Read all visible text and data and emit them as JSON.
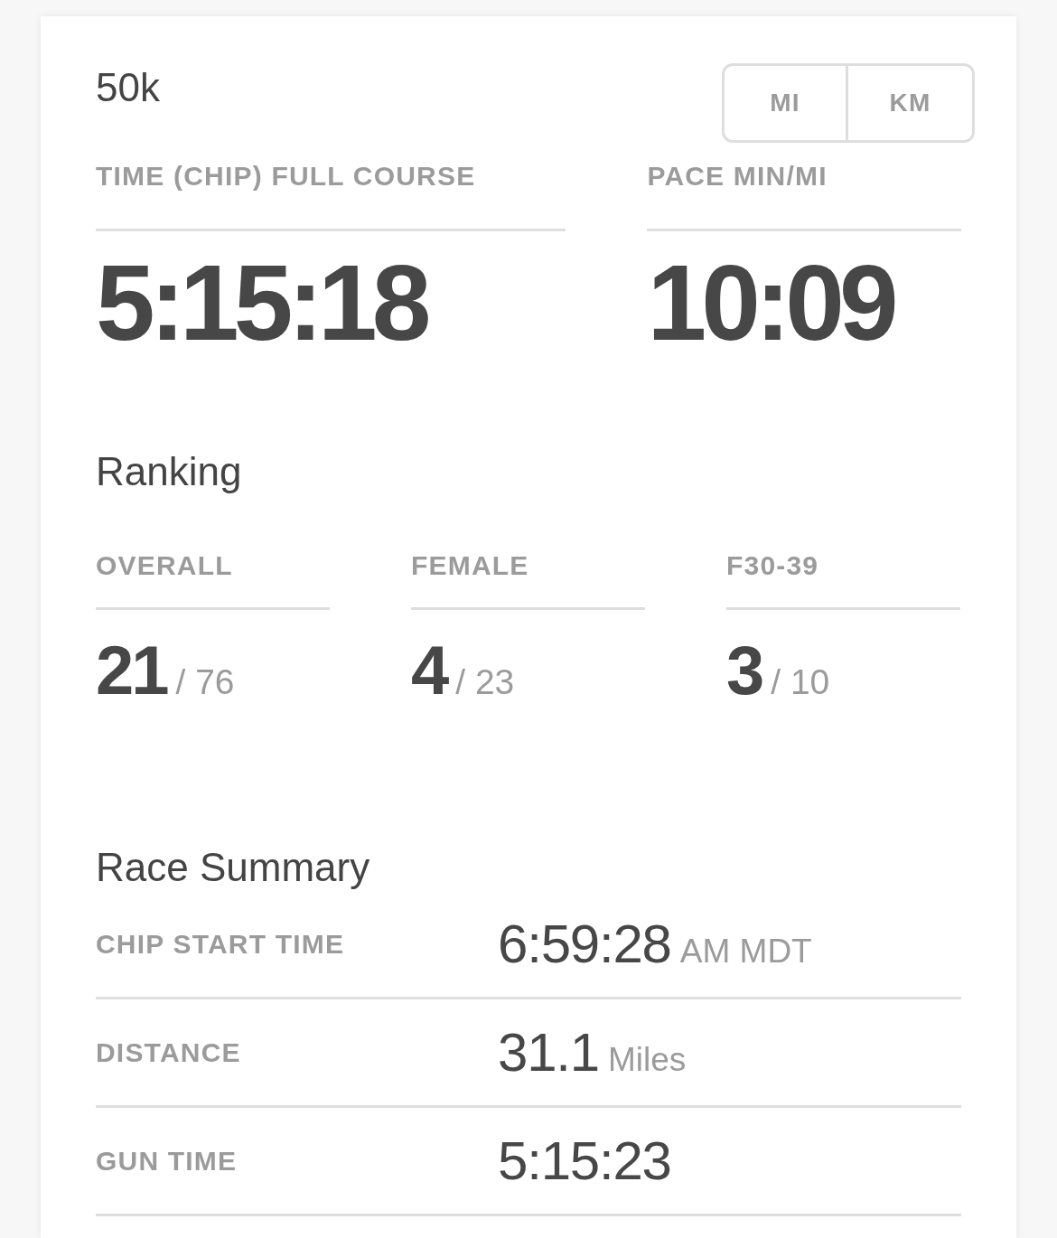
{
  "event": {
    "title": "50k"
  },
  "unit_toggle": [
    {
      "label": "MI"
    },
    {
      "label": "KM"
    }
  ],
  "results": [
    {
      "label": "TIME (CHIP) FULL COURSE",
      "value": "5:15:18"
    },
    {
      "label": "PACE MIN/MI",
      "value": "10:09"
    }
  ],
  "ranking": {
    "title": "Ranking",
    "items": [
      {
        "label": "OVERALL",
        "place": "21",
        "total": "/ 76"
      },
      {
        "label": "FEMALE",
        "place": "4",
        "total": "/ 23"
      },
      {
        "label": "F30-39",
        "place": "3",
        "total": "/ 10"
      }
    ]
  },
  "race_summary": {
    "title": "Race Summary",
    "rows": [
      {
        "label": "CHIP START TIME",
        "value": "6:59:28",
        "unit": "AM MDT"
      },
      {
        "label": "DISTANCE",
        "value": "31.1",
        "unit": "Miles"
      },
      {
        "label": "GUN TIME",
        "value": "5:15:23"
      }
    ]
  }
}
